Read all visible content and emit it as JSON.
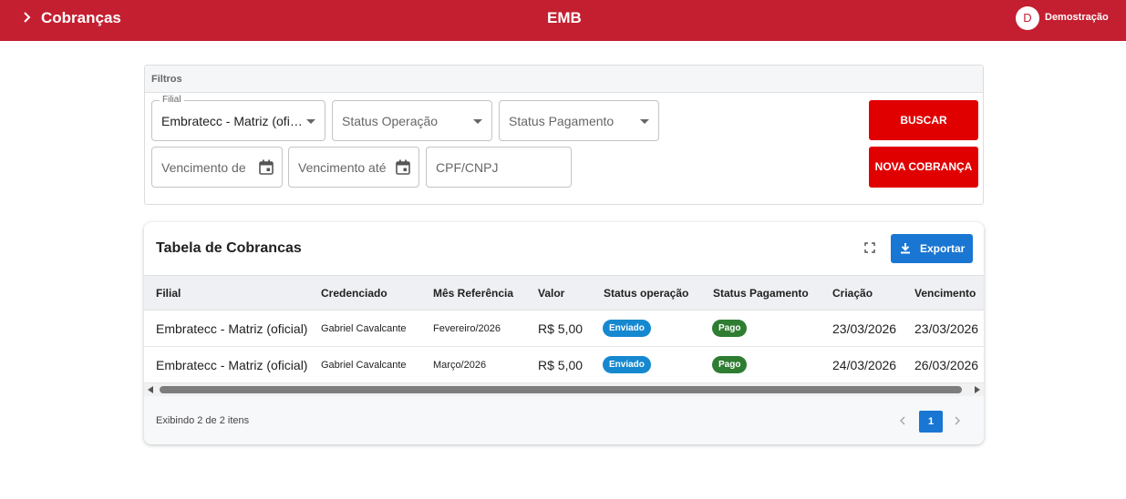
{
  "header": {
    "title": "Cobranças",
    "brand": "EMB",
    "avatar_initial": "D",
    "user_name": "Demostração",
    "background_color": "#c41f30"
  },
  "filters": {
    "title": "Filtros",
    "filial": {
      "label": "Filial",
      "value": "Embratecc - Matriz (oficial)"
    },
    "status_operacao": {
      "placeholder": "Status Operação"
    },
    "status_pagamento": {
      "placeholder": "Status Pagamento"
    },
    "vencimento_de": {
      "placeholder": "Vencimento de"
    },
    "vencimento_ate": {
      "placeholder": "Vencimento até"
    },
    "cpf_cnpj": {
      "placeholder": "CPF/CNPJ"
    },
    "search_button": "BUSCAR",
    "new_button": "NOVA COBRANÇA",
    "button_color": "#e00000"
  },
  "table": {
    "title": "Tabela de Cobrancas",
    "export_label": "Exportar",
    "columns": [
      "Filial",
      "Credenciado",
      "Mês Referência",
      "Valor",
      "Status operação",
      "Status Pagamento",
      "Criação",
      "Vencimento"
    ],
    "rows": [
      {
        "filial": "Embratecc - Matriz (oficial)",
        "credenciado": "Gabriel Cavalcante",
        "mes": "Fevereiro/2026",
        "valor": "R$ 5,00",
        "status_operacao": "Enviado",
        "status_pagamento": "Pago",
        "criacao": "23/03/2026",
        "vencimento": "23/03/2026"
      },
      {
        "filial": "Embratecc - Matriz (oficial)",
        "credenciado": "Gabriel Cavalcante",
        "mes": "Março/2026",
        "valor": "R$ 5,00",
        "status_operacao": "Enviado",
        "status_pagamento": "Pago",
        "criacao": "24/03/2026",
        "vencimento": "26/03/2026"
      }
    ],
    "status_colors": {
      "enviado": "#1588d0",
      "pago": "#2e7d32"
    },
    "footer_info": "Exibindo 2 de 2 itens",
    "current_page": "1"
  }
}
